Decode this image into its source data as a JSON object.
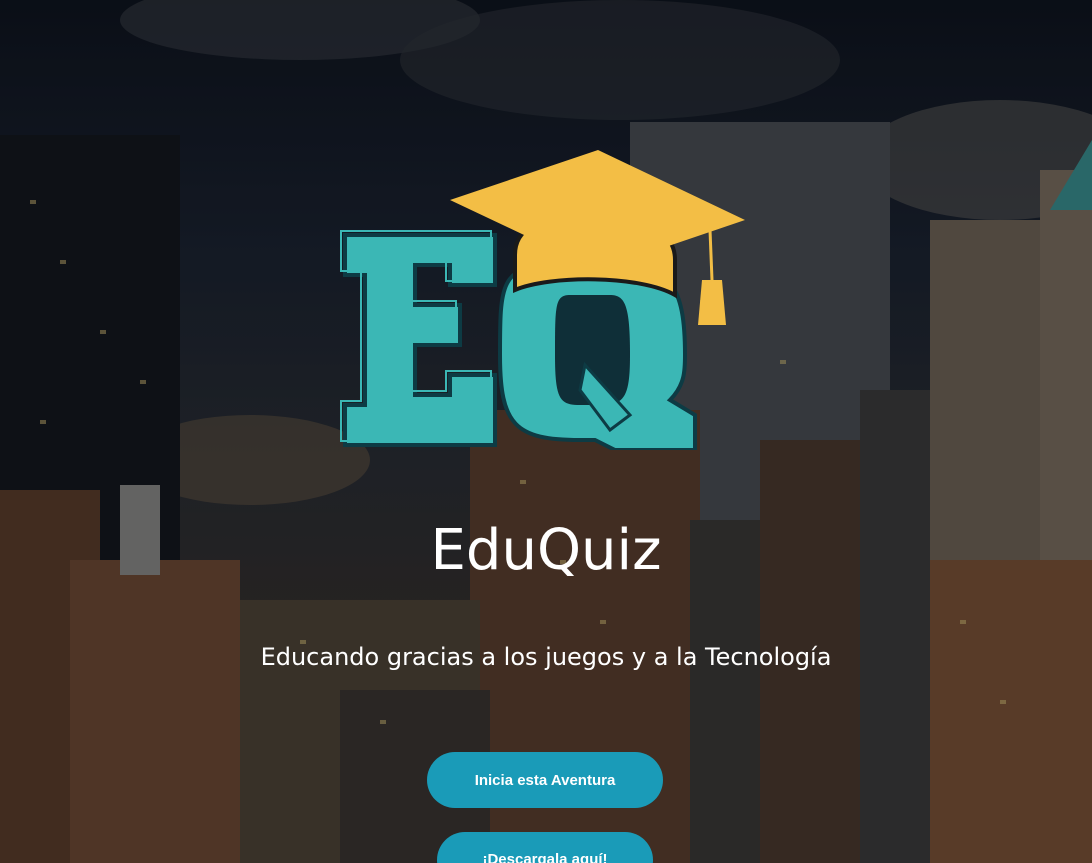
{
  "app": {
    "title": "EduQuiz",
    "tagline": "Educando gracias a los juegos y a la Tecnología"
  },
  "logo": {
    "letters": "EQ",
    "icon": "graduation-cap-icon"
  },
  "buttons": {
    "start_label": "Inicia esta Aventura",
    "download_label": "¡Descargala aquí!"
  },
  "colors": {
    "accent": "#1a9bb8",
    "logo_teal": "#3bb7b5",
    "logo_gold": "#f3be45",
    "text": "#ffffff"
  }
}
